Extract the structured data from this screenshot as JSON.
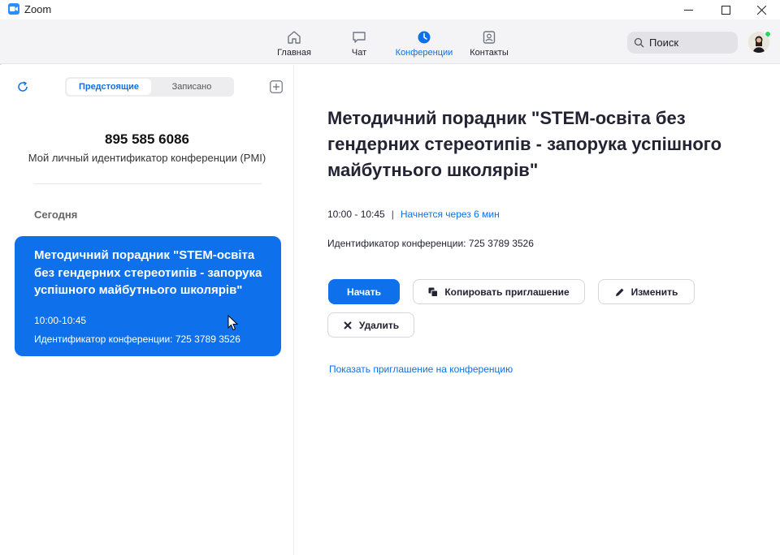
{
  "window": {
    "title": "Zoom",
    "controls": {
      "minimize": "minimize-icon",
      "maximize": "maximize-icon",
      "close": "close-icon"
    }
  },
  "nav": {
    "items": [
      {
        "label": "Главная",
        "icon": "home-icon"
      },
      {
        "label": "Чат",
        "icon": "chat-icon"
      },
      {
        "label": "Конференции",
        "icon": "clock-icon",
        "active": true
      },
      {
        "label": "Контакты",
        "icon": "contacts-icon"
      }
    ],
    "search_placeholder": "Поиск",
    "accent": "#0e71eb",
    "status_color": "#23d959"
  },
  "left": {
    "tabs": {
      "upcoming": "Предстоящие",
      "recorded": "Записано"
    },
    "pmi": {
      "number": "895 585 6086",
      "label": "Мой личный идентификатор конференции (PMI)"
    },
    "today_label": "Сегодня",
    "card": {
      "title": "Методичний порадник \"STEM-освіта без гендерних стереотипів - запорука успішного майбутнього школярів\"",
      "time": "10:00-10:45",
      "meeting_id": "Идентификатор конференции: 725 3789 3526"
    }
  },
  "detail": {
    "title": "Методичний порадник \"STEM-освіта без гендерних стереотипів - запорука успішного майбутнього школярів\"",
    "time": "10:00 - 10:45",
    "separator": "|",
    "starts_in": "Начнется через 6 мин",
    "meeting_id": "Идентификатор конференции: 725 3789 3526",
    "buttons": {
      "start": "Начать",
      "copy": "Копировать приглашение",
      "edit": "Изменить",
      "delete": "Удалить"
    },
    "show_invite": "Показать приглашение на конференцию"
  }
}
